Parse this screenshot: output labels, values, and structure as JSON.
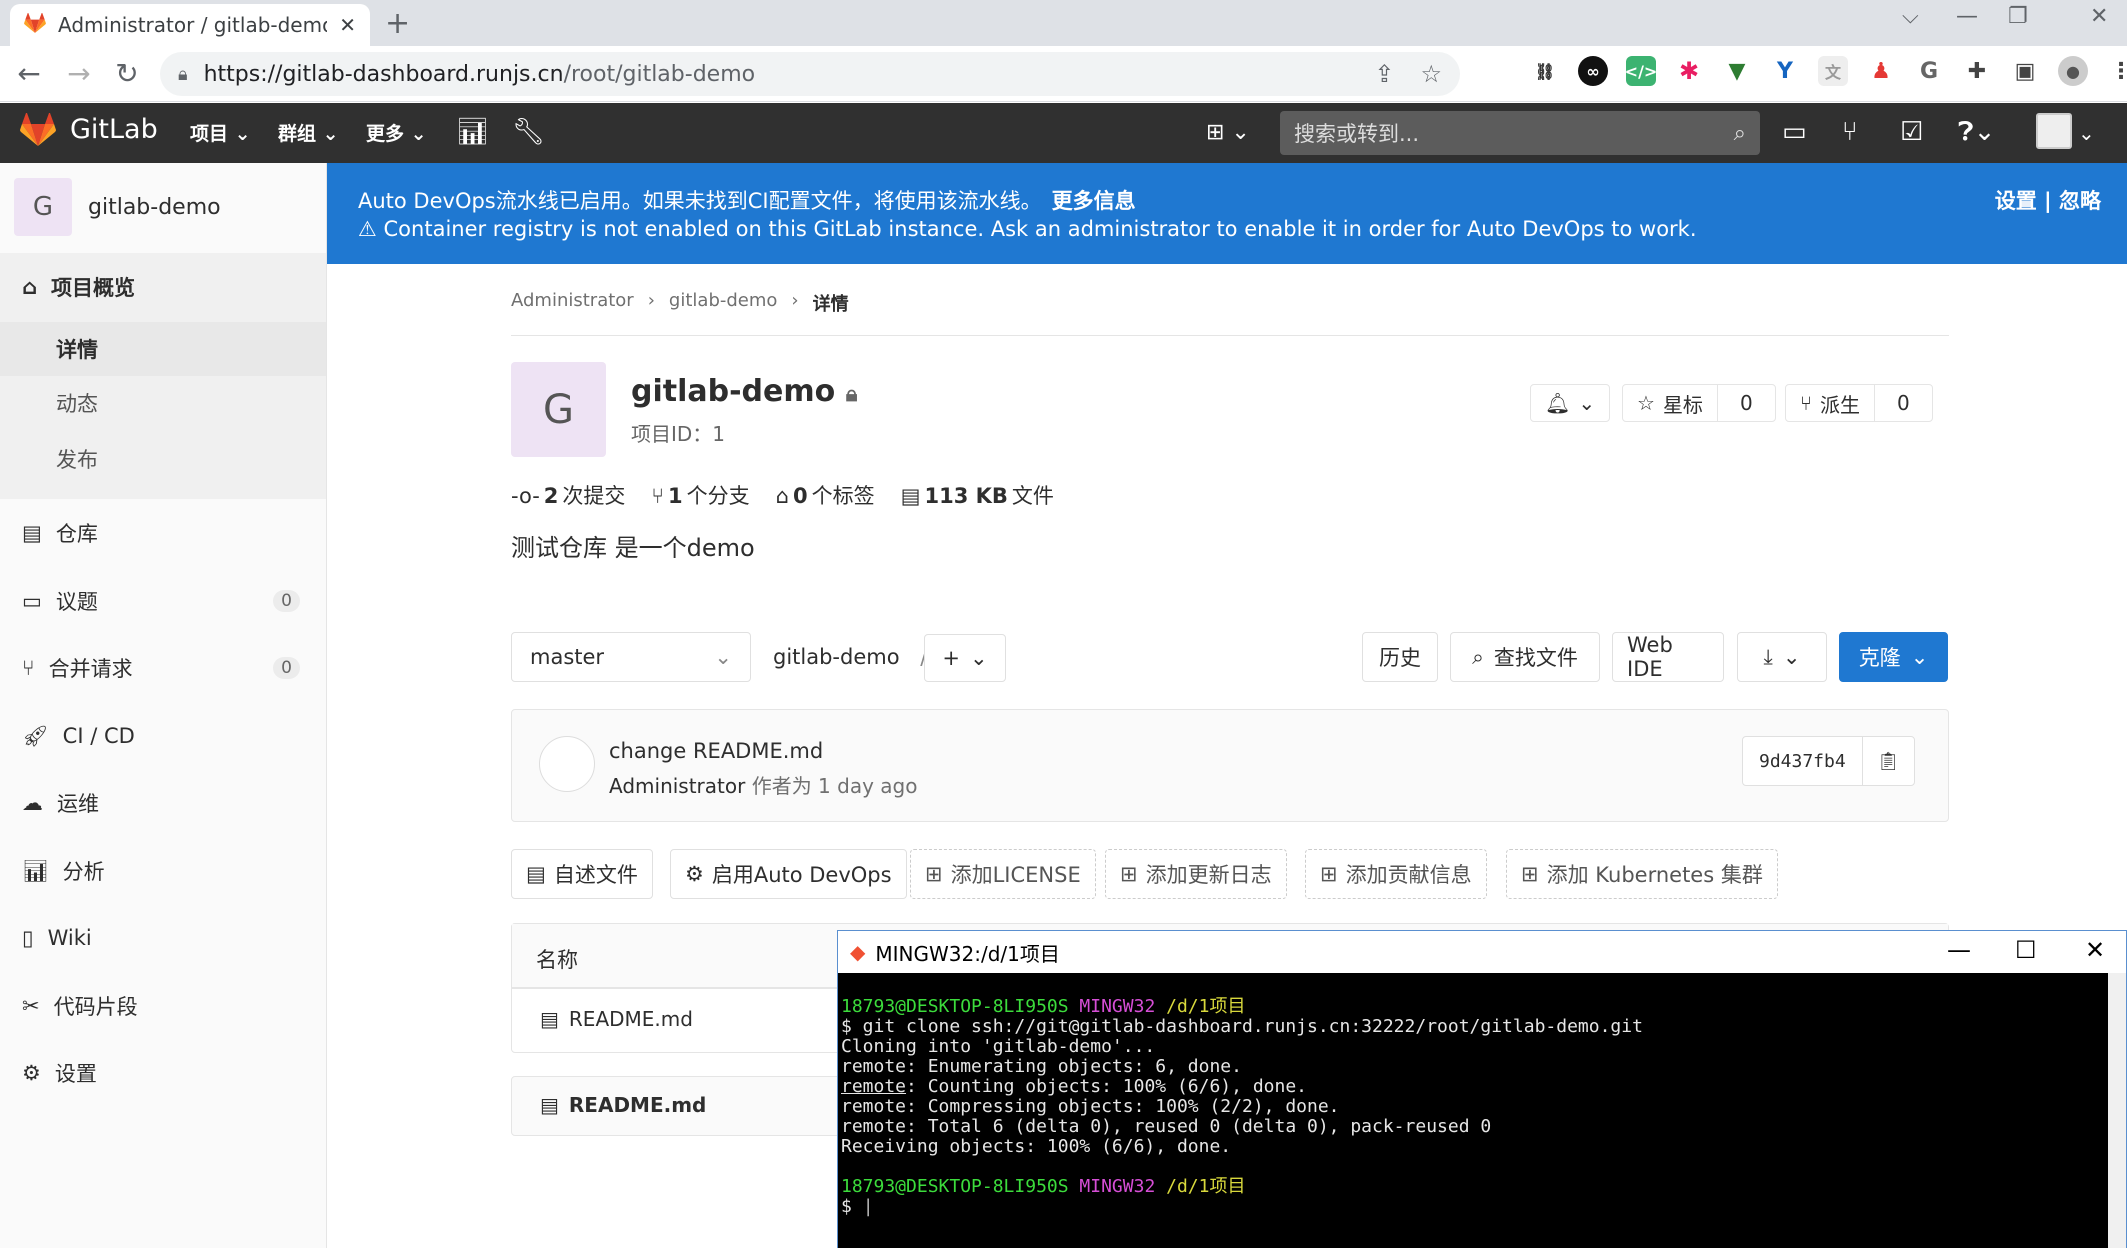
{
  "browser": {
    "tab_title": "Administrator / gitlab-demo · GitLab",
    "new_tab": "+",
    "url_prefix": "https://",
    "url_host": "gitlab-dashboard.runjs.cn",
    "url_path": "/root/gitlab-demo"
  },
  "gitlab_nav": {
    "logo_text": "GitLab",
    "menus": [
      "项目",
      "群组",
      "更多"
    ],
    "search_placeholder": "搜索或转到..."
  },
  "sidebar": {
    "project_initial": "G",
    "project_name": "gitlab-demo",
    "overview": "项目概览",
    "overview_sub": [
      "详情",
      "动态",
      "发布"
    ],
    "items": [
      {
        "label": "仓库"
      },
      {
        "label": "议题",
        "count": "0"
      },
      {
        "label": "合并请求",
        "count": "0"
      },
      {
        "label": "CI / CD"
      },
      {
        "label": "运维"
      },
      {
        "label": "分析"
      },
      {
        "label": "Wiki"
      },
      {
        "label": "代码片段"
      },
      {
        "label": "设置"
      }
    ]
  },
  "banner": {
    "line1": "Auto DevOps流水线已启用。如果未找到CI配置文件，将使用该流水线。",
    "line1_link": "更多信息",
    "line2": "Container registry is not enabled on this GitLab instance. Ask an administrator to enable it in order for Auto DevOps to work.",
    "right": "设置 | 忽略"
  },
  "breadcrumb": [
    "Administrator",
    "gitlab-demo",
    "详情"
  ],
  "project": {
    "initial": "G",
    "title": "gitlab-demo",
    "id_label": "项目ID：1",
    "star_label": "星标",
    "star_count": "0",
    "fork_label": "派生",
    "fork_count": "0",
    "stats": [
      {
        "num": "2",
        "label": "次提交"
      },
      {
        "num": "1",
        "label": "个分支"
      },
      {
        "num": "0",
        "label": "个标签"
      },
      {
        "num": "113 KB",
        "label": "文件"
      }
    ],
    "description": "测试仓库 是一个demo"
  },
  "repo_bar": {
    "branch": "master",
    "path": "gitlab-demo",
    "slash": "/",
    "history": "历史",
    "find_file": "查找文件",
    "web_ide": "Web IDE",
    "clone": "克隆"
  },
  "commit": {
    "message": "change README.md",
    "author": "Administrator",
    "authored": "作者为 1 day ago",
    "sha": "9d437fb4"
  },
  "quick_actions": [
    "自述文件",
    "启用Auto DevOps",
    "添加LICENSE",
    "添加更新日志",
    "添加贡献信息",
    "添加 Kubernetes 集群"
  ],
  "file_table": {
    "header_name": "名称",
    "rows": [
      "README.md"
    ]
  },
  "readme": {
    "title": "README.md"
  },
  "terminal": {
    "title": "MINGW32:/d/1项目",
    "prompt_user": "18793@DESKTOP-8LI950S",
    "prompt_env": "MINGW32",
    "prompt_path": "/d/1项目",
    "command": "$ git clone ssh://git@gitlab-dashboard.runjs.cn:32222/root/gitlab-demo.git",
    "out1": "Cloning into 'gitlab-demo'...",
    "out2": "remote: Enumerating objects: 6, done.",
    "out3_word": "remote",
    "out3_rest": ": Counting objects: 100% (6/6), done.",
    "out4": "remote: Compressing objects: 100% (2/2), done.",
    "out5": "remote: Total 6 (delta 0), reused 0 (delta 0), pack-reused 0",
    "out6": "Receiving objects: 100% (6/6), done.",
    "final_prompt": "$ "
  }
}
